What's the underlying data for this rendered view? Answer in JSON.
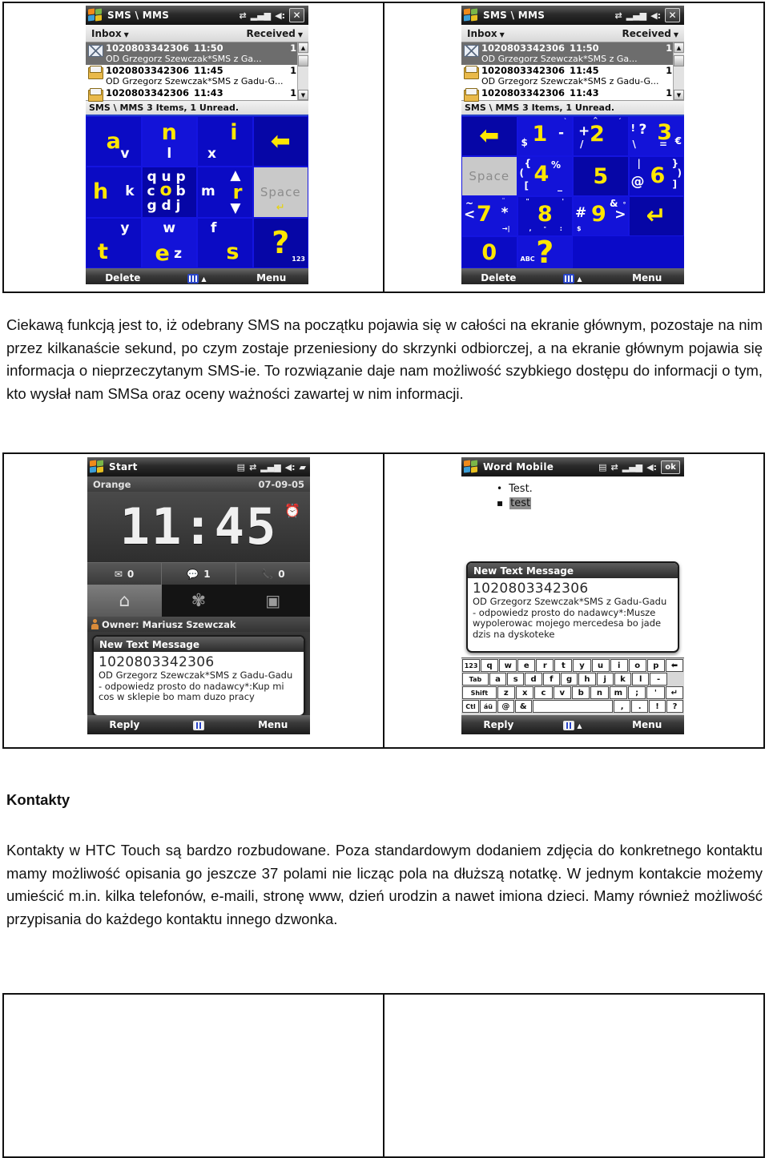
{
  "document": {
    "heading_kontakty": "Kontakty",
    "para_sms": "Ciekawą funkcją jest to, iż odebrany SMS na początku pojawia się w całości na ekranie głównym, pozostaje na nim przez kilkanaście sekund, po czym zostaje przeniesiony do skrzynki odbiorczej, a na ekranie głównym pojawia się informacja o nieprzeczytanym SMS-ie. To rozwiązanie daje nam możliwość szybkiego dostępu do informacji o tym, kto wysłał nam SMSa oraz oceny ważności zawartej w nim informacji.",
    "para_kontakty": "Kontakty w HTC Touch są bardzo rozbudowane. Poza standardowym dodaniem zdjęcia do konkretnego kontaktu mamy możliwość opisania go jeszcze 37 polami nie licząc pola na dłuższą notatkę. W jednym kontakcie możemy umieścić m.in. kilka telefonów, e-maili, stronę www, dzień urodzin a nawet imiona dzieci. Mamy również możliwość przypisania do każdego kontaktu innego dzwonka."
  },
  "sms_app": {
    "title": "SMS \\ MMS",
    "folder": "Inbox",
    "sort": "Received",
    "status": "SMS \\ MMS  3 Items, 1 Unread.",
    "softkeys": {
      "left": "Delete",
      "right": "Menu"
    },
    "messages": [
      {
        "number": "1020803342306",
        "time": "11:50",
        "size": "1K",
        "preview": "OD Grzegorz Szewczak*SMS z Ga...",
        "unread": true
      },
      {
        "number": "1020803342306",
        "time": "11:45",
        "size": "1K",
        "preview": "OD Grzegorz Szewczak*SMS z Gadu-G...",
        "unread": false
      },
      {
        "number": "1020803342306",
        "time": "11:43",
        "size": "1K",
        "preview": "",
        "unread": false
      }
    ],
    "titlebar_icons": [
      "connectivity-icon",
      "signal-icon",
      "volume-icon",
      "close-icon"
    ]
  },
  "keypad_letters": {
    "mode_indicator": "c",
    "keys": [
      {
        "main": "a",
        "sub": "v"
      },
      {
        "main": "n",
        "sub": "l"
      },
      {
        "main": "i",
        "sub": "x"
      },
      {
        "main": "backspace-arrow",
        "sub": ""
      },
      {
        "main": "h",
        "sub": "k"
      },
      {
        "main": "o",
        "subs": [
          "q",
          "u",
          "p",
          "c",
          "b",
          "g",
          "d",
          "j"
        ]
      },
      {
        "main": "r",
        "sub": "m"
      },
      {
        "main": "Space",
        "sub": "enter-arrow"
      },
      {
        "main": "t",
        "sub": "y"
      },
      {
        "main": "e",
        "subs": [
          "w",
          "z"
        ]
      },
      {
        "main": "s",
        "sub": "f"
      },
      {
        "main": "?",
        "sub": "123"
      }
    ]
  },
  "keypad_symbols": {
    "keys": [
      {
        "main": "backspace-arrow"
      },
      {
        "main": "1",
        "subs": [
          "$",
          "-",
          "`"
        ]
      },
      {
        "main": "2",
        "subs": [
          "+",
          "/",
          "^"
        ]
      },
      {
        "main": "3",
        "subs": [
          "!",
          "?",
          "=",
          "\\",
          "€"
        ]
      },
      {
        "main": "Space",
        "sub": "enter-arrow"
      },
      {
        "main": "4",
        "subs": [
          "{",
          "(",
          "[",
          "%",
          "_"
        ]
      },
      {
        "main": "5"
      },
      {
        "main": "6",
        "subs": [
          "|",
          "@",
          "}",
          ")",
          "]"
        ]
      },
      {
        "main": "7",
        "subs": [
          "~",
          "<",
          "*",
          "\"",
          "→"
        ]
      },
      {
        "main": "8",
        "subs": [
          "\"",
          ",",
          "-",
          "'",
          ":"
        ]
      },
      {
        "main": "9",
        "subs": [
          "#",
          "&",
          ">",
          "°",
          "$"
        ]
      },
      {
        "main": "enter-arrow"
      },
      {
        "main": "0"
      },
      {
        "main": "?",
        "sub": "ABC"
      }
    ]
  },
  "today_screen": {
    "start_label": "Start",
    "operator": "Orange",
    "date": "07-09-05",
    "clock": "11:45",
    "counters": [
      {
        "icon": "email-icon",
        "value": "0"
      },
      {
        "icon": "sms-icon",
        "value": "1"
      },
      {
        "icon": "missed-call-icon",
        "value": "0"
      }
    ],
    "launcher": [
      "home-icon",
      "settings-icon",
      "programs-icon"
    ],
    "owner": "Owner: Mariusz Szewczak",
    "titlebar_icons": [
      "sync-icon",
      "connectivity-icon",
      "signal-icon",
      "volume-icon",
      "battery-icon"
    ]
  },
  "popup_today": {
    "title": "New Text Message",
    "number": "1020803342306",
    "body": "OD Grzegorz Szewczak*SMS z Gadu-Gadu - odpowiedz prosto do nadawcy*:Kup mi cos w sklepie bo mam duzo pracy",
    "softkeys": {
      "left": "Reply",
      "right": "Menu"
    }
  },
  "word_mobile": {
    "title": "Word Mobile",
    "ok_label": "ok",
    "bullets": [
      "Test.",
      "test"
    ],
    "titlebar_icons": [
      "sync-icon",
      "connectivity-icon",
      "signal-icon",
      "volume-icon"
    ]
  },
  "popup_word": {
    "title": "New Text Message",
    "number": "1020803342306",
    "body": "OD Grzegorz Szewczak*SMS z Gadu-Gadu - odpowiedz prosto do nadawcy*:Musze wypolerowac mojego mercedesa bo jade dzis na dyskoteke",
    "softkeys": {
      "left": "Reply",
      "right": "Menu"
    }
  },
  "qwerty_keyboard": {
    "rows": [
      [
        "123",
        "q",
        "w",
        "e",
        "r",
        "t",
        "y",
        "u",
        "i",
        "o",
        "p",
        "⬅"
      ],
      [
        "Tab",
        "a",
        "s",
        "d",
        "f",
        "g",
        "h",
        "j",
        "k",
        "l",
        "-"
      ],
      [
        "Shift",
        "z",
        "x",
        "c",
        "v",
        "b",
        "n",
        "m",
        ";",
        "'",
        "↵"
      ],
      [
        "Ctl",
        "áü",
        "@",
        "&",
        "",
        ",",
        ".",
        "!",
        "?"
      ]
    ]
  },
  "colors": {
    "keypad_blue": "#0b0bc4",
    "keypad_yellow": "#ffe600",
    "selection_gray": "#6d6d6d",
    "titlebar_dark": "#151515"
  }
}
